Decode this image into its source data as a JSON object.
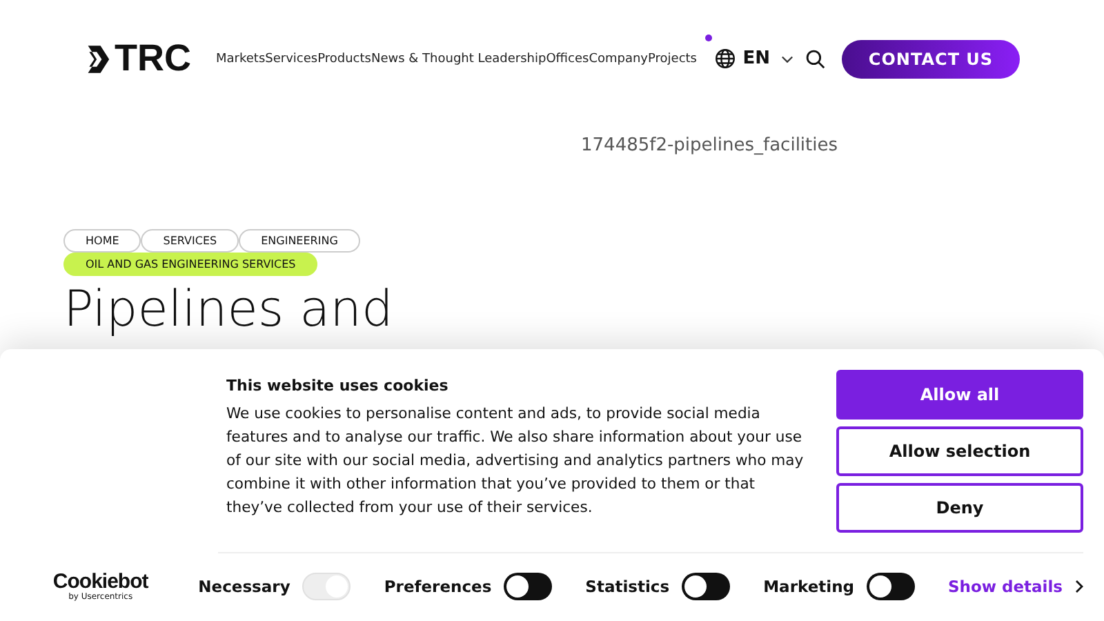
{
  "header": {
    "logo": "TRC",
    "nav": [
      "Markets",
      "Services",
      "Products",
      "News & Thought Leadership",
      "Offices",
      "Company",
      "Projects"
    ],
    "language": "EN",
    "contact_button": "CONTACT US"
  },
  "image_alt": "174485f2-pipelines_facilities",
  "breadcrumbs": [
    {
      "label": "HOME",
      "selected": false
    },
    {
      "label": "SERVICES",
      "selected": false
    },
    {
      "label": "ENGINEERING",
      "selected": false
    },
    {
      "label": "OIL AND GAS ENGINEERING SERVICES",
      "selected": true
    }
  ],
  "heading": "Pipelines and",
  "cookie_banner": {
    "brand": "Cookiebot",
    "brand_sub": "by Usercentrics",
    "title": "This website uses cookies",
    "body": "We use cookies to personalise content and ads, to provide social media features and to analyse our traffic. We also share information about your use of our site with our social media, advertising and analytics partners who may combine it with other information that you’ve provided to them or that they’ve collected from your use of their services.",
    "buttons": [
      {
        "label": "Allow all",
        "kind": "primary"
      },
      {
        "label": "Allow selection",
        "kind": "outline"
      },
      {
        "label": "Deny",
        "kind": "outline"
      }
    ],
    "toggles": [
      {
        "label": "Necessary",
        "checked": true,
        "disabled": true
      },
      {
        "label": "Preferences",
        "checked": false,
        "disabled": false
      },
      {
        "label": "Statistics",
        "checked": false,
        "disabled": false
      },
      {
        "label": "Marketing",
        "checked": false,
        "disabled": false
      }
    ],
    "details_link": "Show details"
  }
}
